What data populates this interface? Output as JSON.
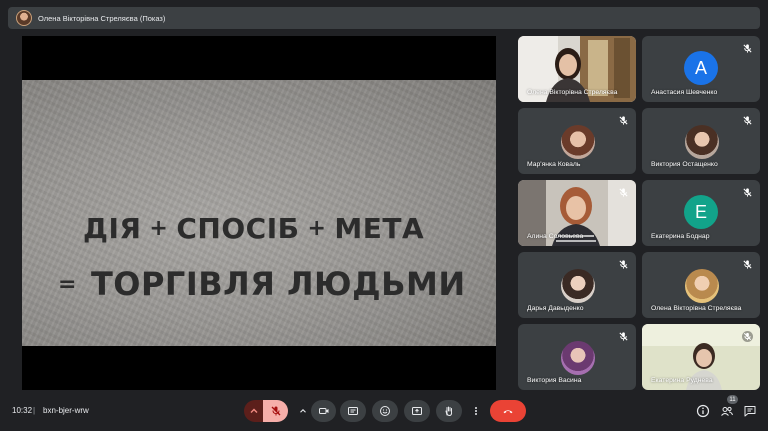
{
  "topbar": {
    "presenter_label": "Олена Вікторівна Стреляєва (Показ)"
  },
  "slide": {
    "line1_word1": "ДІЯ",
    "line1_word2": "СПОСІБ",
    "line1_word3": "МЕТА",
    "line2": "ТОРГІВЛЯ ЛЮДЬМИ",
    "plus_sign": "+",
    "equals_sign": "="
  },
  "participants": [
    {
      "name": "Олена Вікторівна Стреляєва",
      "muted": false,
      "type": "camera"
    },
    {
      "name": "Анастасия Шевченко",
      "muted": true,
      "type": "letter",
      "letter": "A",
      "color": "#1a73e8"
    },
    {
      "name": "Мар'янка Коваль",
      "muted": true,
      "type": "photo"
    },
    {
      "name": "Виктория Остащенко",
      "muted": true,
      "type": "photo"
    },
    {
      "name": "Алина Соловьева",
      "muted": true,
      "type": "camera"
    },
    {
      "name": "Екатерина Боднар",
      "muted": true,
      "type": "letter",
      "letter": "E",
      "color": "#12a38a"
    },
    {
      "name": "Дарья Давыденко",
      "muted": true,
      "type": "photo"
    },
    {
      "name": "Олена Вікторівна Стреляєва",
      "muted": true,
      "type": "photo"
    },
    {
      "name": "Виктория Васина",
      "muted": true,
      "type": "photo"
    },
    {
      "name": "Екатерина Руднева",
      "muted": true,
      "type": "camera"
    }
  ],
  "bottombar": {
    "time": "10:32",
    "separator": "|",
    "meeting_code": "bxn-bjer-wrw",
    "participant_count": "11"
  },
  "colors": {
    "end_call": "#ea4335",
    "mic_off_bg": "#f28b82",
    "bar_bg": "#3c4043"
  }
}
